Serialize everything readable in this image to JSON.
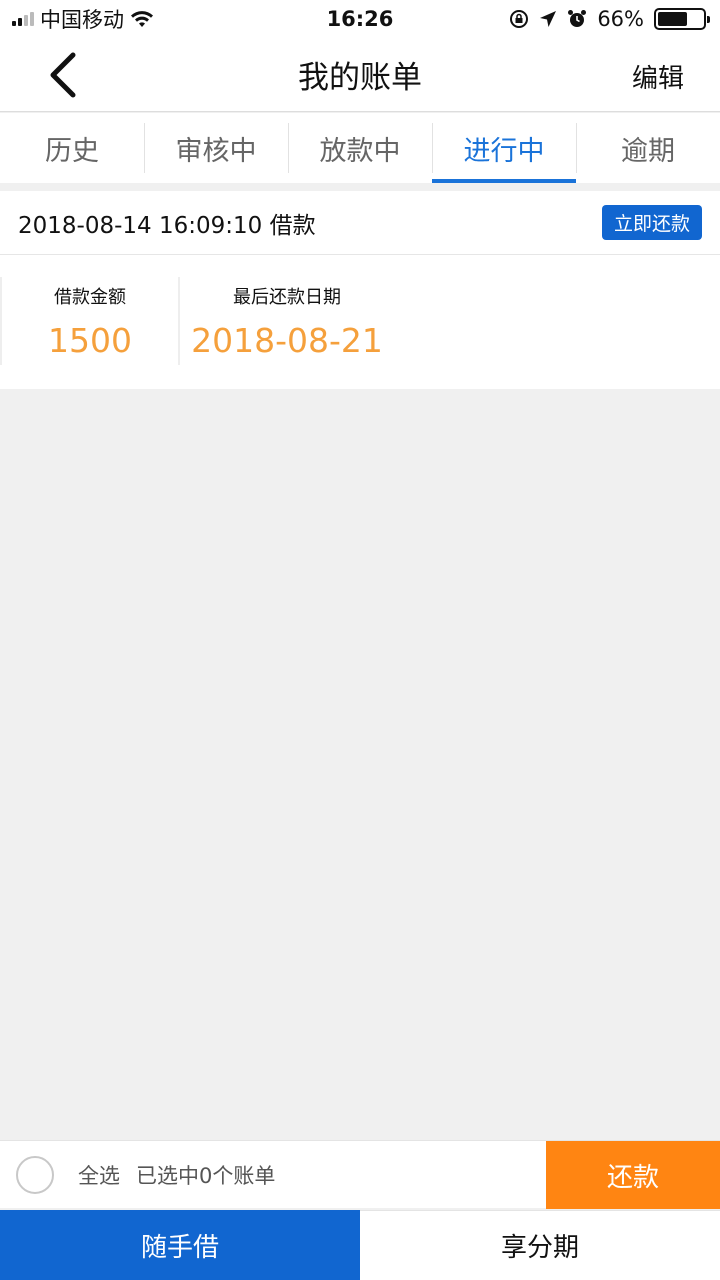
{
  "status_bar": {
    "carrier": "中国移动",
    "time": "16:26",
    "battery_percent": "66%",
    "battery_level": 0.66,
    "icons": [
      "signal-icon",
      "wifi-icon",
      "rotation-lock-icon",
      "location-icon",
      "alarm-icon",
      "battery-icon"
    ]
  },
  "nav": {
    "title": "我的账单",
    "edit_label": "编辑",
    "back_icon": "back-chevron-icon"
  },
  "tabs": [
    {
      "label": "历史",
      "active": false
    },
    {
      "label": "审核中",
      "active": false
    },
    {
      "label": "放款中",
      "active": false
    },
    {
      "label": "进行中",
      "active": true
    },
    {
      "label": "逾期",
      "active": false
    }
  ],
  "loan": {
    "title": "2018-08-14 16:09:10 借款",
    "repay_now_label": "立即还款",
    "amount_label": "借款金额",
    "amount_value": "1500",
    "due_label": "最后还款日期",
    "due_value": "2018-08-21"
  },
  "select_bar": {
    "select_all_label": "全选",
    "selected_text": "已选中0个账单",
    "repay_label": "还款"
  },
  "bottom_tabs": [
    {
      "label": "随手借",
      "active": true
    },
    {
      "label": "享分期",
      "active": false
    }
  ],
  "colors": {
    "accent_blue": "#1a73d9",
    "button_blue": "#1166d0",
    "orange": "#ff8512",
    "value_orange": "#f5a03c"
  }
}
